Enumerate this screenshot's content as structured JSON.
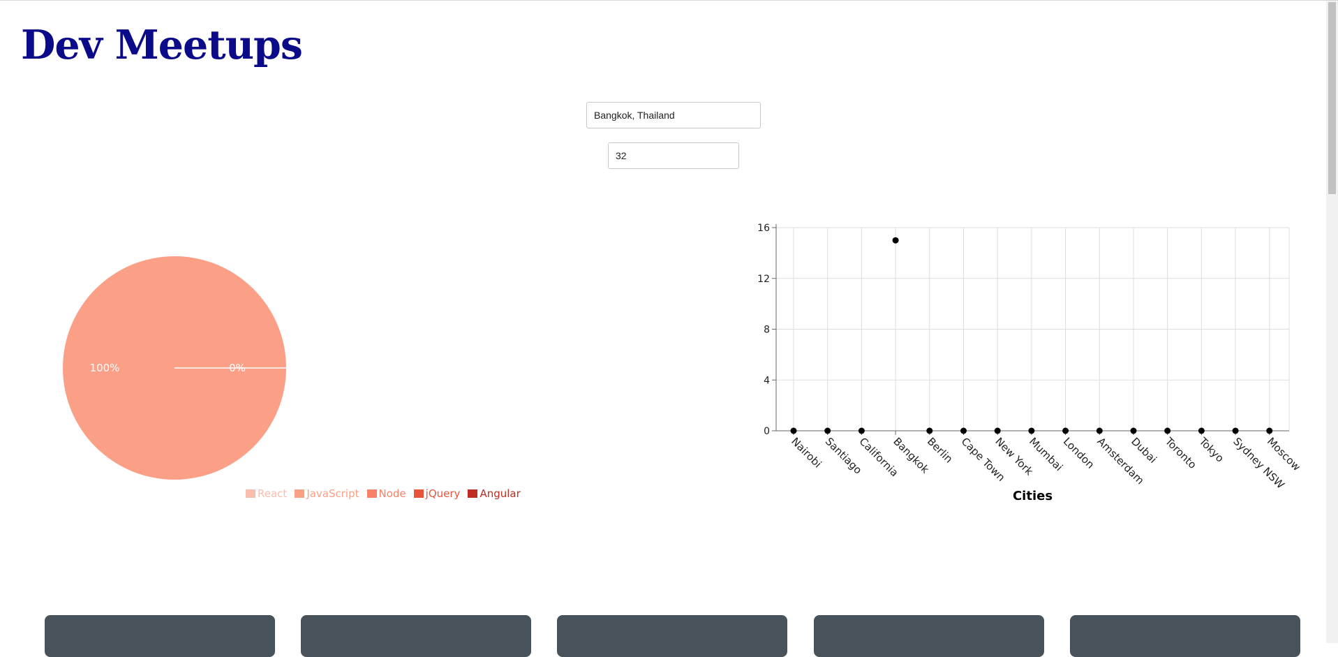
{
  "header": {
    "title": "Dev Meetups"
  },
  "inputs": {
    "city_value": "Bangkok, Thailand",
    "count_value": "32"
  },
  "chart_data": [
    {
      "type": "pie",
      "slices": [
        {
          "name": "React",
          "value": 0,
          "color": "#f9bdad"
        },
        {
          "name": "JavaScript",
          "value": 100,
          "color": "#fc9f87"
        },
        {
          "name": "Node",
          "value": 0,
          "color": "#f7826a"
        },
        {
          "name": "jQuery",
          "value": 0,
          "color": "#e8533c"
        },
        {
          "name": "Angular",
          "value": 0,
          "color": "#bf2d22"
        }
      ],
      "data_labels": [
        "100%",
        "0%"
      ],
      "legend_position": "bottom-right"
    },
    {
      "type": "scatter",
      "categories": [
        "Nairobi",
        "Santiago",
        "California",
        "Bangkok",
        "Berlin",
        "Cape Town",
        "New York",
        "Mumbai",
        "London",
        "Amsterdam",
        "Dubai",
        "Toronto",
        "Tokyo",
        "Sydney NSW",
        "Moscow"
      ],
      "values": [
        0,
        0,
        0,
        15,
        0,
        0,
        0,
        0,
        0,
        0,
        0,
        0,
        0,
        0,
        0
      ],
      "xlabel": "Cities",
      "ylabel": "",
      "ylim": [
        0,
        16
      ],
      "yticks": [
        0,
        4,
        8,
        12,
        16
      ],
      "grid": true
    }
  ],
  "cards": {
    "count": 5,
    "color": "#47525b"
  }
}
